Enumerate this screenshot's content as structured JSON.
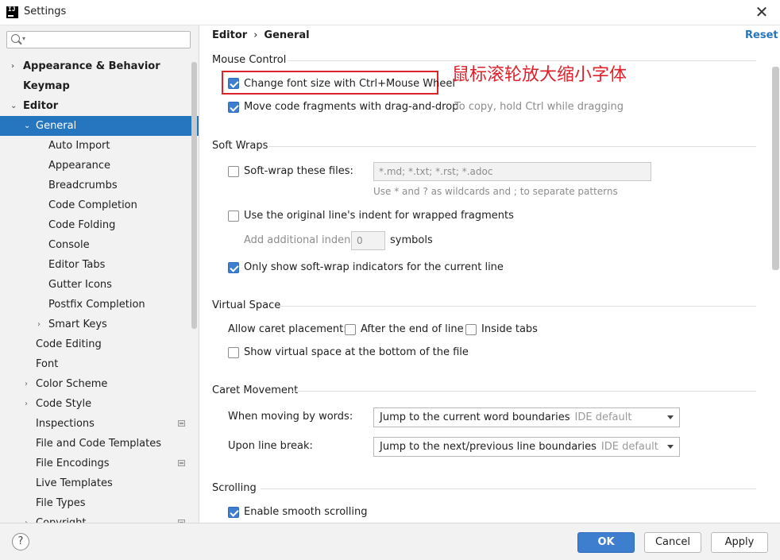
{
  "window": {
    "title": "Settings",
    "close": "✕",
    "app_icon": "IJ"
  },
  "search": {
    "value": ""
  },
  "sidebar": {
    "items": [
      {
        "label": "Appearance & Behavior"
      },
      {
        "label": "Keymap"
      },
      {
        "label": "Editor"
      },
      {
        "label": "General"
      },
      {
        "label": "Auto Import"
      },
      {
        "label": "Appearance"
      },
      {
        "label": "Breadcrumbs"
      },
      {
        "label": "Code Completion"
      },
      {
        "label": "Code Folding"
      },
      {
        "label": "Console"
      },
      {
        "label": "Editor Tabs"
      },
      {
        "label": "Gutter Icons"
      },
      {
        "label": "Postfix Completion"
      },
      {
        "label": "Smart Keys"
      },
      {
        "label": "Code Editing"
      },
      {
        "label": "Font"
      },
      {
        "label": "Color Scheme"
      },
      {
        "label": "Code Style"
      },
      {
        "label": "Inspections"
      },
      {
        "label": "File and Code Templates"
      },
      {
        "label": "File Encodings"
      },
      {
        "label": "Live Templates"
      },
      {
        "label": "File Types"
      },
      {
        "label": "Copyright"
      }
    ]
  },
  "breadcrumb": {
    "parent": "Editor",
    "separator": "›",
    "current": "General"
  },
  "reset_label": "Reset",
  "annotation": "鼠标滚轮放大缩小字体",
  "mouse_control": {
    "title": "Mouse Control",
    "change_font_size": "Change font size with Ctrl+Mouse Wheel",
    "change_font_size_checked": true,
    "drag_drop": "Move code fragments with drag-and-drop",
    "drag_drop_checked": true,
    "drag_drop_hint": "To copy, hold Ctrl while dragging"
  },
  "soft_wraps": {
    "title": "Soft Wraps",
    "soft_wrap_files": "Soft-wrap these files:",
    "soft_wrap_files_checked": false,
    "files_placeholder": "*.md; *.txt; *.rst; *.adoc",
    "files_hint": "Use * and ? as wildcards and ; to separate patterns",
    "original_indent": "Use the original line's indent for wrapped fragments",
    "original_indent_checked": false,
    "additional_indent_label": "Add additional indent:",
    "additional_indent_value": "0",
    "symbols_label": "symbols",
    "only_current": "Only show soft-wrap indicators for the current line",
    "only_current_checked": true
  },
  "virtual_space": {
    "title": "Virtual Space",
    "caret_placement_label": "Allow caret placement:",
    "after_end": "After the end of line",
    "after_end_checked": false,
    "inside_tabs": "Inside tabs",
    "inside_tabs_checked": false,
    "show_virtual": "Show virtual space at the bottom of the file",
    "show_virtual_checked": false
  },
  "caret_movement": {
    "title": "Caret Movement",
    "moving_words_label": "When moving by words:",
    "moving_words_value": "Jump to the current word boundaries",
    "moving_words_default": "IDE default",
    "line_break_label": "Upon line break:",
    "line_break_value": "Jump to the next/previous line boundaries",
    "line_break_default": "IDE default"
  },
  "scrolling": {
    "title": "Scrolling",
    "smooth": "Enable smooth scrolling",
    "smooth_checked": true
  },
  "buttons": {
    "help": "?",
    "ok": "OK",
    "cancel": "Cancel",
    "apply": "Apply"
  },
  "colors": {
    "accent": "#2675bf",
    "annotation": "#e0202a",
    "checkbox": "#3d7fce"
  }
}
